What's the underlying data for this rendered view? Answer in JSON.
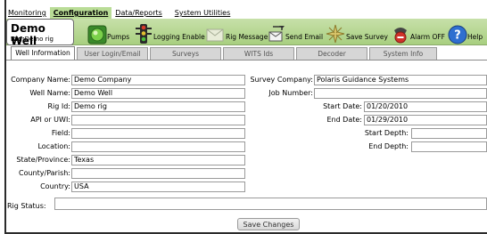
{
  "menu": [
    {
      "label": "Monitoring",
      "active": false
    },
    {
      "label": "Configuration",
      "active": true
    },
    {
      "label": "Data/Reports",
      "active": false
    },
    {
      "label": "System Utilities",
      "active": false
    }
  ],
  "well": {
    "name": "Demo Well",
    "rig_label": "Rig:",
    "rig_value": "Demo rig"
  },
  "toolbar": {
    "pumps": "Pumps",
    "logging_enable": "Logging Enable",
    "rig_message": "Rig Message",
    "send_email": "Send Email",
    "save_survey": "Save Survey",
    "alarm_off": "Alarm OFF",
    "help": "Help"
  },
  "tabs": [
    {
      "label": "Well Information",
      "active": true
    },
    {
      "label": "User Login/Email",
      "active": false
    },
    {
      "label": "Surveys",
      "active": false
    },
    {
      "label": "WITS Ids",
      "active": false
    },
    {
      "label": "Decoder",
      "active": false
    },
    {
      "label": "System Info",
      "active": false
    }
  ],
  "form": {
    "company_name": {
      "label": "Company Name:",
      "value": "Demo Company"
    },
    "well_name": {
      "label": "Well Name:",
      "value": "Demo Well"
    },
    "rig_id": {
      "label": "Rig Id:",
      "value": "Demo rig"
    },
    "api_uwi": {
      "label": "API or UWI:",
      "value": ""
    },
    "field": {
      "label": "Field:",
      "value": ""
    },
    "location": {
      "label": "Location:",
      "value": ""
    },
    "state": {
      "label": "State/Province:",
      "value": "Texas"
    },
    "county": {
      "label": "County/Parish:",
      "value": ""
    },
    "country": {
      "label": "Country:",
      "value": "USA"
    },
    "survey_company": {
      "label": "Survey Company:",
      "value": "Polaris Guidance Systems"
    },
    "job_number": {
      "label": "Job Number:",
      "value": ""
    },
    "start_date": {
      "label": "Start Date:",
      "value": "01/20/2010"
    },
    "end_date": {
      "label": "End Date:",
      "value": "01/29/2010"
    },
    "start_depth": {
      "label": "Start Depth:",
      "value": ""
    },
    "end_depth": {
      "label": "End Depth:",
      "value": ""
    },
    "rig_status": {
      "label": "Rig Status:",
      "value": ""
    }
  },
  "save_button": "Save Changes",
  "colors": {
    "toolbar_green": "#b4d58e",
    "active_menu": "#b9dc96",
    "tab_inactive": "#d6d6d6"
  }
}
